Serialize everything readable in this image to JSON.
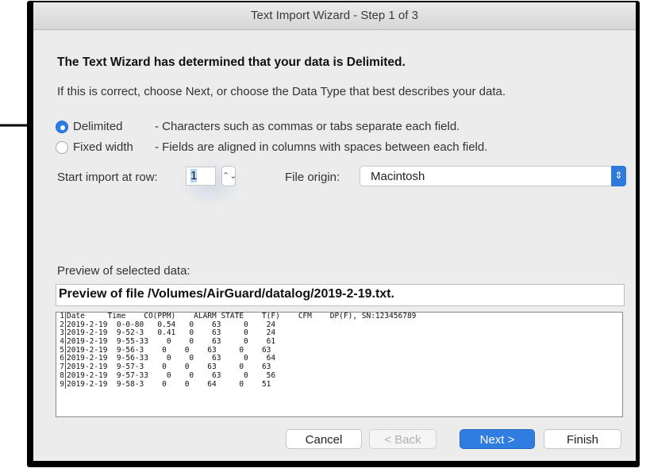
{
  "window": {
    "title": "Text Import Wizard - Step 1 of 3"
  },
  "intro": {
    "heading": "The Text Wizard has determined that your data is Delimited.",
    "subtext": "If this is correct, choose Next, or choose the Data Type that best describes your data."
  },
  "data_type": {
    "selected": "Delimited",
    "options": [
      {
        "label": "Delimited",
        "description": "- Characters such as commas or tabs separate each field.",
        "checked": true
      },
      {
        "label": "Fixed width",
        "description": "- Fields are aligned in columns with spaces between each field.",
        "checked": false
      }
    ]
  },
  "start_row": {
    "label": "Start import at row:",
    "value": "1"
  },
  "file_origin": {
    "label": "File origin:",
    "value": "Macintosh"
  },
  "preview": {
    "label": "Preview of selected data:",
    "file_title": "Preview of file /Volumes/AirGuard/datalog/2019-2-19.txt.",
    "rows": [
      {
        "num": "1",
        "text": "Date     Time    CO(PPM)    ALARM STATE    T(F)    CFM    DP(F), SN:123456789"
      },
      {
        "num": "2",
        "text": "2019-2-19  0-0-80   0.54   0    63     0    24"
      },
      {
        "num": "3",
        "text": "2019-2-19  9-52-3   0.41   0    63     0    24"
      },
      {
        "num": "4",
        "text": "2019-2-19  9-55-33    0    0    63     0    61"
      },
      {
        "num": "5",
        "text": "2019-2-19  9-56-3    0    0    63     0    63"
      },
      {
        "num": "6",
        "text": "2019-2-19  9-56-33    0    0    63     0    64"
      },
      {
        "num": "7",
        "text": "2019-2-19  9-57-3    0    0    63     0    63"
      },
      {
        "num": "8",
        "text": "2019-2-19  9-57-33    0    0    63     0    56"
      },
      {
        "num": "9",
        "text": "2019-2-19  9-58-3    0    0    64     0    51"
      }
    ]
  },
  "buttons": {
    "cancel": "Cancel",
    "back": "< Back",
    "next": "Next >",
    "finish": "Finish"
  },
  "colors": {
    "accent": "#2f7de0",
    "annotation_arrow": "#000000"
  }
}
